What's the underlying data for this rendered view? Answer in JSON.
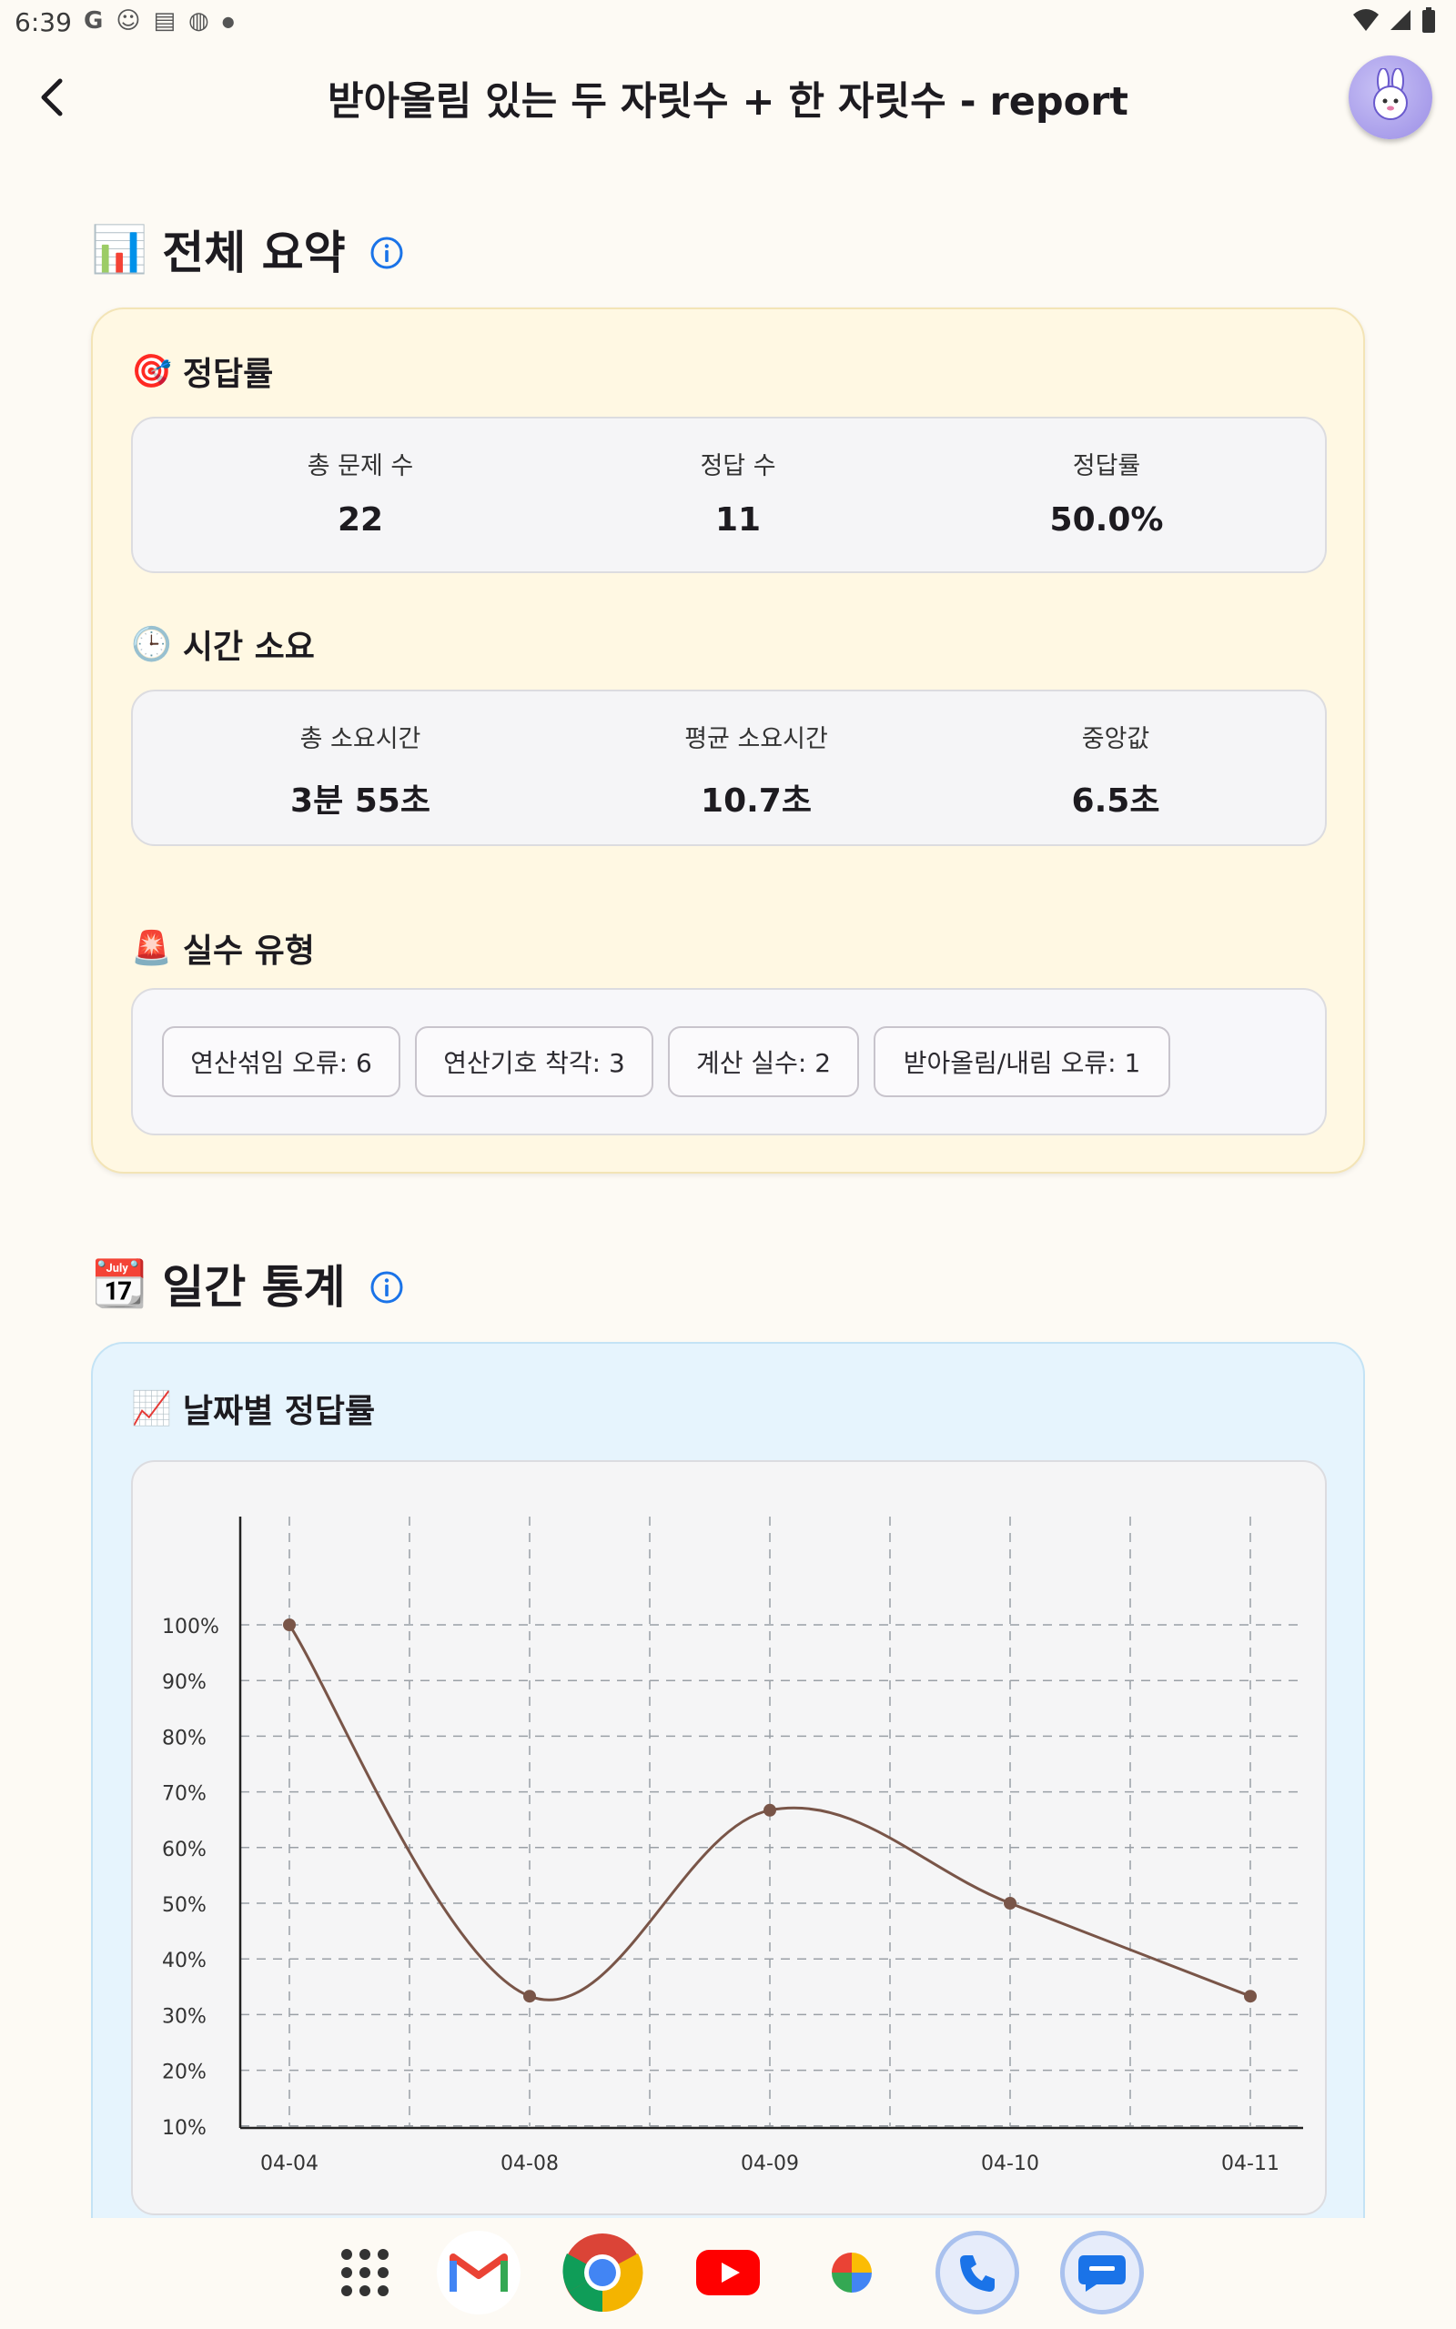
{
  "status_bar": {
    "time": "6:39",
    "left_icons": [
      "google-icon",
      "face-icon",
      "calendar-icon",
      "globe-icon",
      "dot-icon"
    ],
    "right_icons": [
      "wifi-icon",
      "signal-icon",
      "battery-icon"
    ]
  },
  "app_bar": {
    "title": "받아올림 있는 두 자릿수 + 한 자릿수 - report",
    "back_icon": "chevron-left-icon",
    "avatar_icon": "rabbit-avatar-icon"
  },
  "summary": {
    "emoji": "📊",
    "title": "전체 요약",
    "accuracy": {
      "emoji": "🎯",
      "title": "정답률",
      "stats": [
        {
          "label": "총 문제 수",
          "value": "22"
        },
        {
          "label": "정답 수",
          "value": "11"
        },
        {
          "label": "정답률",
          "value": "50.0%"
        }
      ]
    },
    "time": {
      "emoji": "🕒",
      "title": "시간 소요",
      "stats": [
        {
          "label": "총 소요시간",
          "value": "3분 55초"
        },
        {
          "label": "평균 소요시간",
          "value": "10.7초"
        },
        {
          "label": "중앙값",
          "value": "6.5초"
        }
      ]
    },
    "errors": {
      "emoji": "🚨",
      "title": "실수 유형",
      "chips": [
        "연산섞임 오류: 6",
        "연산기호 착각: 3",
        "계산 실수: 2",
        "받아올림/내림 오류: 1"
      ]
    }
  },
  "daily": {
    "emoji": "📆",
    "title": "일간 통계",
    "chart_title_emoji": "📈",
    "chart_title": "날짜별 정답률"
  },
  "chart_data": {
    "type": "line",
    "title": "날짜별 정답률",
    "xlabel": "",
    "ylabel": "",
    "categories": [
      "04-04",
      "04-08",
      "04-09",
      "04-10",
      "04-11"
    ],
    "series": [
      {
        "values": [
          100,
          33.3,
          66.7,
          50,
          33.3
        ]
      }
    ],
    "y_ticks": [
      "10%",
      "20%",
      "30%",
      "40%",
      "50%",
      "60%",
      "70%",
      "80%",
      "90%",
      "100%"
    ],
    "ylim": [
      0,
      110
    ],
    "grid": true,
    "line_color": "#795548"
  },
  "nav_bar": {
    "apps": [
      "app-drawer-icon",
      "gmail-icon",
      "chrome-icon",
      "youtube-icon",
      "photos-icon",
      "phone-icon",
      "messages-icon"
    ]
  }
}
